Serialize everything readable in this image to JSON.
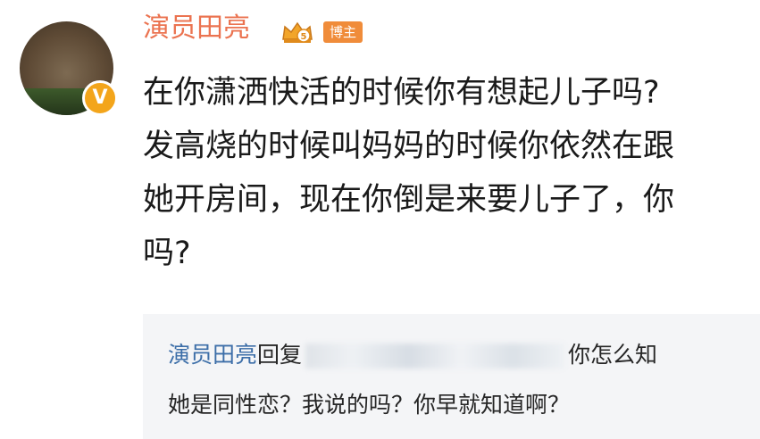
{
  "comment": {
    "username": "演员田亮",
    "badge": "博主",
    "verified_mark": "V",
    "lines": [
      "在你潇洒快活的时候你有想起儿子吗?",
      "发高烧的时候叫妈妈的时候你依然在跟",
      "她开房间，现在你倒是来要儿子了，你",
      "吗?"
    ]
  },
  "reply": {
    "author": "演员田亮",
    "reply_word": "回复",
    "after_blur": "你怎么知",
    "line2": "她是同性恋？我说的吗？你早就知道啊？"
  },
  "colors": {
    "username": "#eb7350",
    "reply_name": "#3c6ea8",
    "verified": "#f3a51b",
    "badge": "#f08c3a",
    "reply_bg": "#f4f5f7"
  },
  "icons": [
    "avatar-image",
    "verified-icon",
    "crown-icon"
  ]
}
